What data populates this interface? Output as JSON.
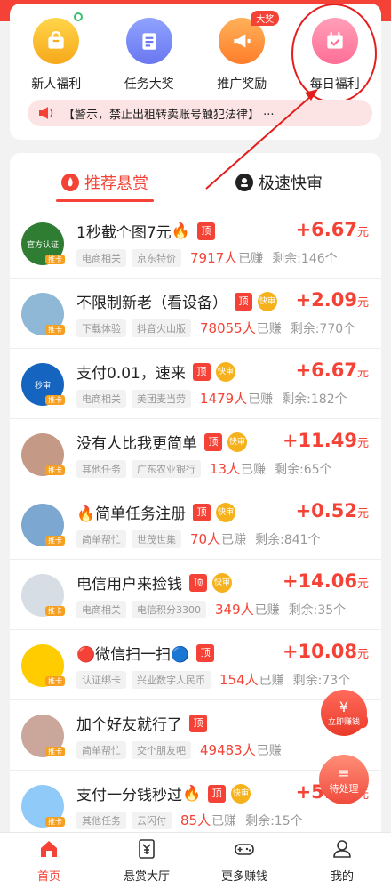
{
  "top_icons": [
    {
      "label": "新人福利",
      "icon": "gift-bag-icon",
      "color": "#f7a81b"
    },
    {
      "label": "任务大奖",
      "icon": "document-icon",
      "color": "#6a77f0"
    },
    {
      "label": "推广奖励",
      "icon": "megaphone-icon",
      "color": "#ff7e2a",
      "badge": "大奖"
    },
    {
      "label": "每日福利",
      "icon": "calendar-icon",
      "color": "#ff6e96"
    }
  ],
  "notice": {
    "text": "【警示，禁止出租转卖账号触犯法律】 ···"
  },
  "tabs": {
    "recommended": "推荐悬赏",
    "fast": "极速快审"
  },
  "tasks": [
    {
      "title": "1秒截个图7元",
      "emoji": "🔥",
      "top": "顶",
      "fast": "",
      "tags": [
        "电商相关",
        "京东特价"
      ],
      "count": "7917人",
      "count_label": "已赚",
      "remain": "剩余:146个",
      "reward": "+6.67",
      "unit": "元",
      "avatar_text": "官方认证"
    },
    {
      "title": "不限制新老（看设备）",
      "emoji": "",
      "top": "顶",
      "fast": "快审",
      "tags": [
        "下载体验",
        "抖音火山版"
      ],
      "count": "78055人",
      "count_label": "已赚",
      "remain": "剩余:770个",
      "reward": "+2.09",
      "unit": "元",
      "avatar_text": ""
    },
    {
      "title": "支付0.01，速来",
      "emoji": "",
      "top": "顶",
      "fast": "快审",
      "tags": [
        "电商相关",
        "美团麦当劳"
      ],
      "count": "1479人",
      "count_label": "已赚",
      "remain": "剩余:182个",
      "reward": "+6.67",
      "unit": "元",
      "avatar_text": "秒审"
    },
    {
      "title": "没有人比我更简单",
      "emoji": "",
      "top": "顶",
      "fast": "快审",
      "tags": [
        "其他任务",
        "广东农业银行"
      ],
      "count": "13人",
      "count_label": "已赚",
      "remain": "剩余:65个",
      "reward": "+11.49",
      "unit": "元",
      "avatar_text": ""
    },
    {
      "title": "🔥简单任务注册",
      "emoji": "",
      "top": "顶",
      "fast": "快审",
      "tags": [
        "简单帮忙",
        "世茂世集"
      ],
      "count": "70人",
      "count_label": "已赚",
      "remain": "剩余:841个",
      "reward": "+0.52",
      "unit": "元",
      "avatar_text": ""
    },
    {
      "title": "电信用户来捡钱",
      "emoji": "",
      "top": "顶",
      "fast": "快审",
      "tags": [
        "电商相关",
        "电信积分3300"
      ],
      "count": "349人",
      "count_label": "已赚",
      "remain": "剩余:35个",
      "reward": "+14.06",
      "unit": "元",
      "avatar_text": ""
    },
    {
      "title": "🔴微信扫一扫🔵",
      "emoji": "",
      "top": "顶",
      "fast": "",
      "tags": [
        "认证绑卡",
        "兴业数字人民币"
      ],
      "count": "154人",
      "count_label": "已赚",
      "remain": "剩余:73个",
      "reward": "+10.08",
      "unit": "元",
      "avatar_text": ""
    },
    {
      "title": "加个好友就行了",
      "emoji": "",
      "top": "顶",
      "fast": "",
      "tags": [
        "简单帮忙",
        "交个朋友吧"
      ],
      "count": "49483人",
      "count_label": "已赚",
      "remain": "",
      "reward": "+0",
      "unit": "",
      "avatar_text": ""
    },
    {
      "title": "支付一分钱秒过",
      "emoji": "🔥",
      "top": "顶",
      "fast": "快审",
      "tags": [
        "其他任务",
        "云闪付"
      ],
      "count": "85人",
      "count_label": "已赚",
      "remain": "剩余:15个",
      "reward": "+5.17",
      "unit": "元",
      "avatar_text": ""
    }
  ],
  "avatar_badge": "推卡",
  "float_buttons": {
    "earn": "立即赚钱",
    "todo": "待处理"
  },
  "bottom_nav": [
    {
      "label": "首页",
      "icon": "home-icon"
    },
    {
      "label": "悬赏大厅",
      "icon": "yuan-doc-icon"
    },
    {
      "label": "更多赚钱",
      "icon": "gamepad-icon"
    },
    {
      "label": "我的",
      "icon": "user-icon"
    }
  ],
  "colors": {
    "accent": "#f44336",
    "badge": "#f6b21c"
  }
}
